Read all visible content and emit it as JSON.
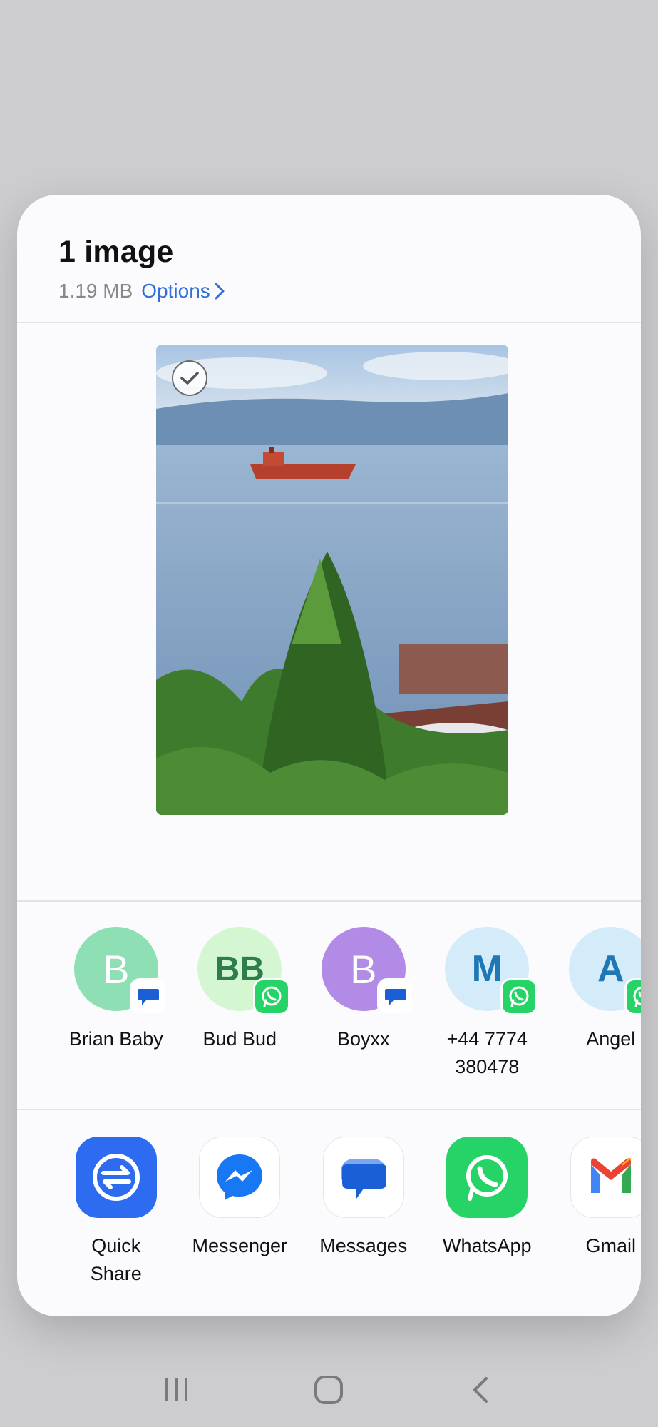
{
  "header": {
    "title": "1 image",
    "size": "1.19 MB",
    "options_label": "Options"
  },
  "contacts": [
    {
      "initials": "B",
      "name": "Brian Baby",
      "bg": "#8ee0b4",
      "fg": "#ffffff",
      "badge": "messages-badge-icon"
    },
    {
      "initials": "BB",
      "name": "Bud Bud",
      "bg": "#d4f7d2",
      "fg": "#2e7d4a",
      "badge": "whatsapp-badge-icon"
    },
    {
      "initials": "B",
      "name": "Boyxx",
      "bg": "#b28be6",
      "fg": "#ffffff",
      "badge": "messages-badge-icon"
    },
    {
      "initials": "M",
      "name": "+44 7774 380478",
      "bg": "#d4ebf9",
      "fg": "#1f78b4",
      "badge": "whatsapp-badge-icon"
    },
    {
      "initials": "A",
      "name": "Angel",
      "bg": "#d4ebf9",
      "fg": "#1f78b4",
      "badge": "whatsapp-badge-icon"
    }
  ],
  "apps": [
    {
      "name": "Quick Share",
      "icon": "quick-share-icon"
    },
    {
      "name": "Messenger",
      "icon": "messenger-icon"
    },
    {
      "name": "Messages",
      "icon": "messages-icon"
    },
    {
      "name": "WhatsApp",
      "icon": "whatsapp-icon"
    },
    {
      "name": "Gmail",
      "icon": "gmail-icon"
    }
  ],
  "colors": {
    "accent": "#2f6fd6",
    "whatsapp": "#25d366",
    "quick_share": "#2d6cf0",
    "messages": "#1a5fd6"
  }
}
